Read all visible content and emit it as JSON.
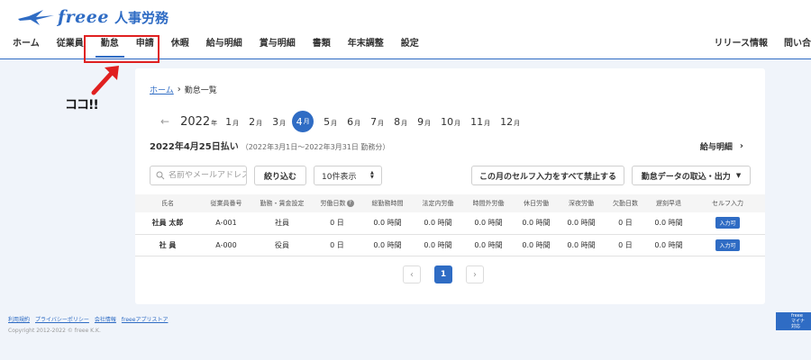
{
  "header": {
    "logo_word": "freee",
    "product": "人事労務",
    "nav": [
      {
        "label": "ホーム"
      },
      {
        "label": "従業員"
      },
      {
        "label": "勤怠",
        "active": true
      },
      {
        "label": "申請"
      },
      {
        "label": "休暇"
      },
      {
        "label": "給与明細"
      },
      {
        "label": "賞与明細"
      },
      {
        "label": "書類"
      },
      {
        "label": "年末調整"
      },
      {
        "label": "設定"
      }
    ],
    "nav_right": [
      {
        "label": "リリース情報"
      },
      {
        "label": "問い合"
      }
    ]
  },
  "annotation": {
    "callout_text": "ココ!!",
    "color": "#e02020"
  },
  "breadcrumb": {
    "home": "ホーム",
    "separator": "›",
    "current": "勤怠一覧"
  },
  "month_selector": {
    "prev": "←",
    "year": "2022",
    "year_suffix": "年",
    "month_suffix": "月",
    "months": [
      "1",
      "2",
      "3",
      "4",
      "5",
      "6",
      "7",
      "8",
      "9",
      "10",
      "11",
      "12"
    ],
    "selected": "4"
  },
  "payday": {
    "title": "2022年4月25日払い",
    "period": "（2022年3月1日〜2022年3月31日 勤務分）",
    "payslip_link": "給与明細",
    "payslip_chevron": "›"
  },
  "controls": {
    "search_placeholder": "名前やメールアドレス",
    "filter_label": "絞り込む",
    "page_size_label": "10件表示",
    "page_size_caret": "▲▼",
    "disable_self_input_label": "この月のセルフ入力をすべて禁止する",
    "import_label": "勤怠データの取込・出力",
    "import_caret": "▼"
  },
  "table": {
    "columns": [
      "氏名",
      "従業員番号",
      "勤務・賃金設定",
      "労働日数",
      "総勤務時間",
      "法定内労働",
      "時間外労働",
      "休日労働",
      "深夜労働",
      "欠勤日数",
      "遅刻早退",
      "セルフ入力"
    ],
    "rows": [
      {
        "name": "社員 太郎",
        "number": "A-001",
        "setting": "社員",
        "work_days": "0 日",
        "total": "0.0 時間",
        "legal": "0.0 時間",
        "overtime": "0.0 時間",
        "holiday": "0.0 時間",
        "night": "0.0 時間",
        "absence": "0 日",
        "late": "0.0 時間",
        "self_input": "入力可"
      },
      {
        "name": "社 員",
        "number": "A-000",
        "setting": "役員",
        "work_days": "0 日",
        "total": "0.0 時間",
        "legal": "0.0 時間",
        "overtime": "0.0 時間",
        "holiday": "0.0 時間",
        "night": "0.0 時間",
        "absence": "0 日",
        "late": "0.0 時間",
        "self_input": "入力可"
      }
    ]
  },
  "pagination": {
    "prev": "‹",
    "current": "1",
    "next": "›"
  },
  "footer": {
    "links": [
      "利用規約",
      "プライバシーポリシー",
      "会社情報",
      "freeeアプリストア"
    ],
    "copyright": "Copyright 2012-2022 © freee K.K.",
    "corner_badge": [
      "freee",
      "マイナ",
      "対応"
    ]
  },
  "colors": {
    "brand": "#2f6cc4",
    "background": "#f0f4fa",
    "highlight": "#e02020"
  }
}
